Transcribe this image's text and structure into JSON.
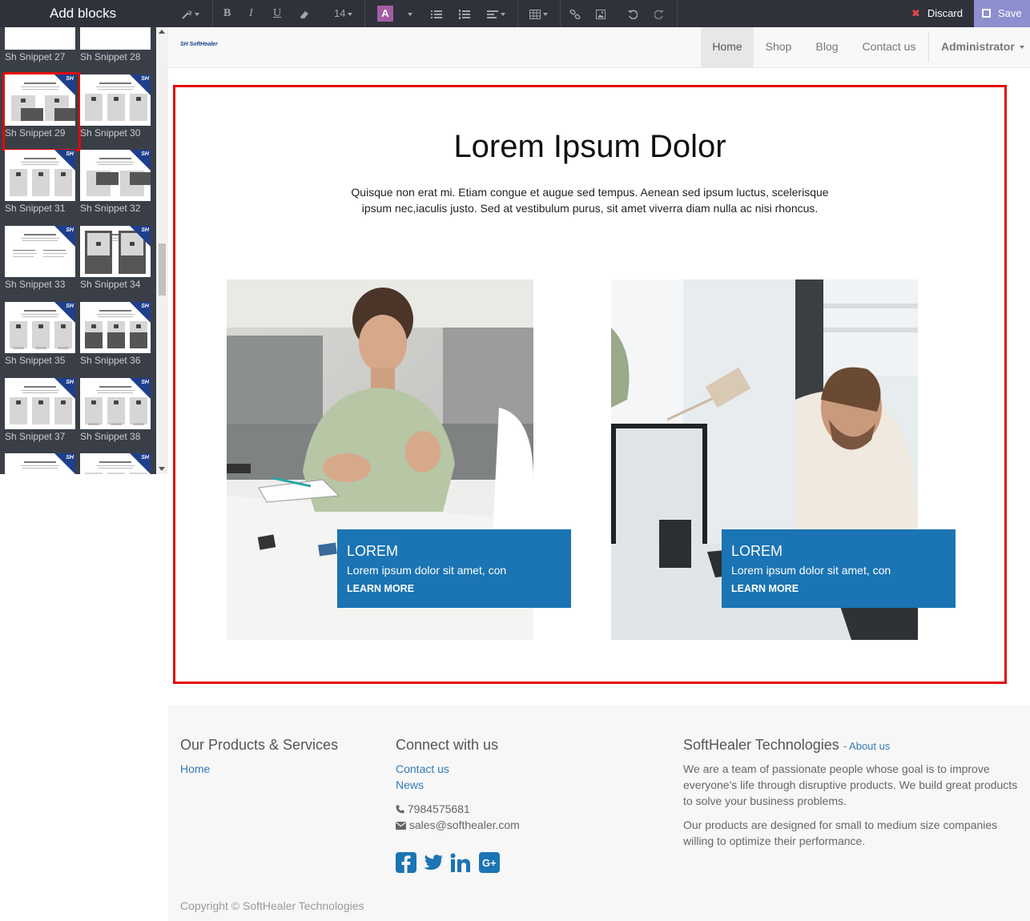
{
  "sidebar": {
    "title": "Add blocks",
    "snippets": [
      {
        "label": "Sh Snippet 27"
      },
      {
        "label": "Sh Snippet 28"
      },
      {
        "label": "Sh Snippet 29"
      },
      {
        "label": "Sh Snippet 30"
      },
      {
        "label": "Sh Snippet 31"
      },
      {
        "label": "Sh Snippet 32"
      },
      {
        "label": "Sh Snippet 33"
      },
      {
        "label": "Sh Snippet 34"
      },
      {
        "label": "Sh Snippet 35"
      },
      {
        "label": "Sh Snippet 36"
      },
      {
        "label": "Sh Snippet 37"
      },
      {
        "label": "Sh Snippet 38"
      }
    ],
    "badge_text": "SH",
    "selected_snippet": "Sh Snippet 29"
  },
  "toolbar": {
    "font_size": "14",
    "bold": "B",
    "italic": "I",
    "underline": "U",
    "color_letter": "A",
    "discard_label": "Discard",
    "save_label": "Save"
  },
  "header": {
    "logo_text": "SH SoftHealer",
    "nav": [
      {
        "label": "Home",
        "active": true
      },
      {
        "label": "Shop"
      },
      {
        "label": "Blog"
      },
      {
        "label": "Contact us"
      }
    ],
    "user_menu": "Administrator"
  },
  "section": {
    "title": "Lorem Ipsum Dolor",
    "description": "Quisque non erat mi. Etiam congue et augue sed tempus. Aenean sed ipsum luctus, scelerisque ipsum nec,iaculis justo. Sed at vestibulum purus, sit amet viverra diam nulla ac nisi rhoncus.",
    "cards": [
      {
        "title": "LOREM",
        "text": "Lorem ipsum dolor sit amet, con",
        "link": "LEARN MORE"
      },
      {
        "title": "LOREM",
        "text": "Lorem ipsum dolor sit amet, con",
        "link": "LEARN MORE"
      }
    ]
  },
  "footer": {
    "col1": {
      "heading": "Our Products & Services",
      "links": [
        "Home"
      ]
    },
    "col2": {
      "heading": "Connect with us",
      "links": [
        "Contact us",
        "News"
      ],
      "phone": "7984575681",
      "email": "sales@softhealer.com",
      "social": [
        "facebook-icon",
        "twitter-icon",
        "linkedin-icon",
        "google-plus-icon"
      ]
    },
    "col3": {
      "heading": "SoftHealer Technologies",
      "about_link": "About us",
      "para1": "We are a team of passionate people whose goal is to improve everyone's life through disruptive products. We build great products to solve your business problems.",
      "para2": "Our products are designed for small to medium size companies willing to optimize their performance."
    },
    "copyright": "Copyright © SoftHealer Technologies"
  },
  "colors": {
    "accent": "#1b74b3",
    "selection": "#e2090c",
    "save": "#8d8fcf",
    "discard": "#e8474b"
  }
}
